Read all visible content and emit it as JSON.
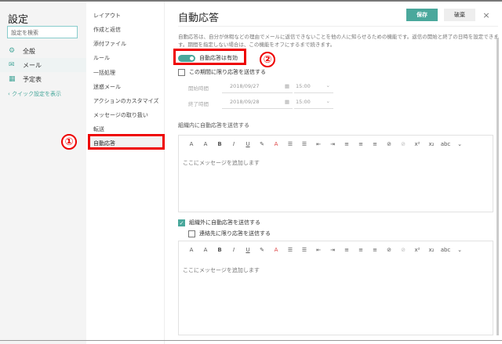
{
  "left": {
    "title": "設定",
    "search_placeholder": "設定を検索",
    "items": [
      {
        "label": "全般",
        "icon": "gear-icon"
      },
      {
        "label": "メール",
        "icon": "mail-icon"
      },
      {
        "label": "予定表",
        "icon": "calendar-icon"
      }
    ],
    "quick": "クイック設定を表示"
  },
  "mid": {
    "items": [
      "レイアウト",
      "作成と返信",
      "添付ファイル",
      "ルール",
      "一括処理",
      "迷惑メール",
      "アクションのカスタマイズ",
      "メッセージの取り扱い",
      "転送",
      "自動応答"
    ]
  },
  "main": {
    "title": "自動応答",
    "save": "保存",
    "discard": "破棄",
    "close": "×",
    "description": "自動応答は、自分が休暇などの理由でメールに返信できないことを他の人に知らせるための機能です。返信の開始と終了の日時を設定できます。期間を指定しない場合は、この機能をオフにするまで続きます。",
    "toggle_label": "自動応答は有効",
    "toggle_on": true,
    "period_label": "この期間に限り応答を送信する",
    "period_checked": false,
    "start_label": "開始時間",
    "start_date": "2018/09/27",
    "start_time": "15:00",
    "end_label": "終了時間",
    "end_date": "2018/09/28",
    "end_time": "15:00",
    "internal_label": "組織内に自動応答を送信する",
    "placeholder": "ここにメッセージを追加します",
    "external_label": "組織外に自動応答を送信する",
    "external_checked": true,
    "contacts_label": "連絡先に限り応答を送信する",
    "contacts_checked": false,
    "toolbar": [
      "A",
      "A",
      "B",
      "I",
      "U",
      "✎",
      "A",
      "☰",
      "☰",
      "⇤",
      "⇥",
      "≡",
      "≡",
      "≡",
      "⊘",
      "⊘",
      "x²",
      "x₂",
      "abc",
      "⌄"
    ],
    "accent": "#4aa89c"
  },
  "annotations": [
    "①",
    "②"
  ]
}
